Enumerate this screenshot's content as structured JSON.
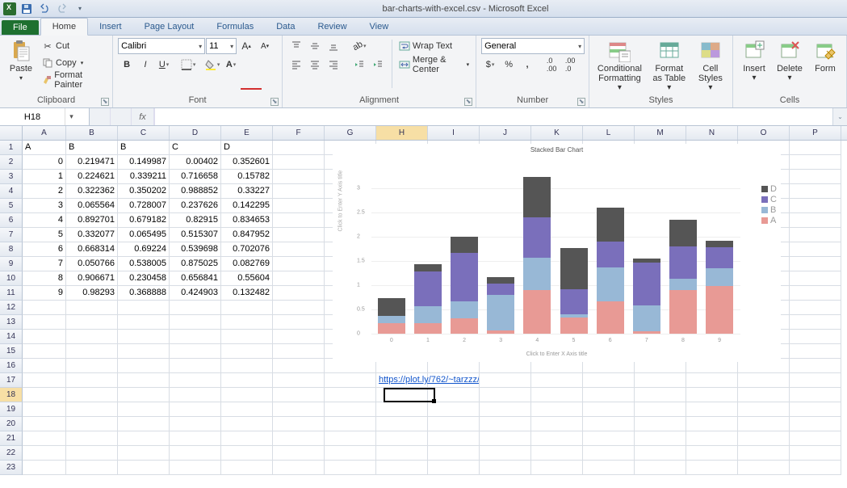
{
  "window_title": "bar-charts-with-excel.csv - Microsoft Excel",
  "tabs": {
    "file": "File",
    "home": "Home",
    "insert": "Insert",
    "page_layout": "Page Layout",
    "formulas": "Formulas",
    "data": "Data",
    "review": "Review",
    "view": "View"
  },
  "clipboard": {
    "paste": "Paste",
    "cut": "Cut",
    "copy": "Copy",
    "fp": "Format Painter",
    "label": "Clipboard"
  },
  "font": {
    "name": "Calibri",
    "size": "11",
    "label": "Font"
  },
  "alignment": {
    "wrap": "Wrap Text",
    "merge": "Merge & Center",
    "label": "Alignment"
  },
  "number": {
    "format": "General",
    "label": "Number"
  },
  "styles": {
    "cf": "Conditional",
    "cf2": "Formatting",
    "ft": "Format",
    "ft2": "as Table",
    "cs": "Cell",
    "cs2": "Styles",
    "label": "Styles"
  },
  "cells": {
    "insert": "Insert",
    "delete": "Delete",
    "format": "Form",
    "label": "Cells"
  },
  "namebox": "H18",
  "col_letters": [
    "A",
    "B",
    "C",
    "D",
    "E",
    "F",
    "G",
    "H",
    "I",
    "J",
    "K",
    "L",
    "M",
    "N",
    "O",
    "P"
  ],
  "header_row": [
    "A",
    "B",
    "B",
    "C",
    "D"
  ],
  "data_rows": [
    [
      "0",
      "0.219471",
      "0.149987",
      "0.00402",
      "0.352601"
    ],
    [
      "1",
      "0.224621",
      "0.339211",
      "0.716658",
      "0.15782"
    ],
    [
      "2",
      "0.322362",
      "0.350202",
      "0.988852",
      "0.33227"
    ],
    [
      "3",
      "0.065564",
      "0.728007",
      "0.237626",
      "0.142295"
    ],
    [
      "4",
      "0.892701",
      "0.679182",
      "0.82915",
      "0.834653"
    ],
    [
      "5",
      "0.332077",
      "0.065495",
      "0.515307",
      "0.847952"
    ],
    [
      "6",
      "0.668314",
      "0.69224",
      "0.539698",
      "0.702076"
    ],
    [
      "7",
      "0.050766",
      "0.538005",
      "0.875025",
      "0.082769"
    ],
    [
      "8",
      "0.906671",
      "0.230458",
      "0.656841",
      "0.55604"
    ],
    [
      "9",
      "0.98293",
      "0.368888",
      "0.424903",
      "0.132482"
    ]
  ],
  "link_cell": "https://plot.ly/762/~tarzzz/",
  "chart_data": {
    "type": "bar",
    "stacked": true,
    "title": "Stacked Bar Chart",
    "xlabel": "Click to Enter X Axis title",
    "ylabel": "Click to Enter Y Axis title",
    "categories": [
      "0",
      "1",
      "2",
      "3",
      "4",
      "5",
      "6",
      "7",
      "8",
      "9"
    ],
    "series": [
      {
        "name": "A",
        "color": "#e89a95",
        "values": [
          0.219471,
          0.224621,
          0.322362,
          0.065564,
          0.892701,
          0.332077,
          0.668314,
          0.050766,
          0.906671,
          0.98293
        ]
      },
      {
        "name": "B",
        "color": "#98b8d6",
        "values": [
          0.149987,
          0.339211,
          0.350202,
          0.728007,
          0.679182,
          0.065495,
          0.69224,
          0.538005,
          0.230458,
          0.368888
        ]
      },
      {
        "name": "C",
        "color": "#7a6fbb",
        "values": [
          0.00402,
          0.716658,
          0.988852,
          0.237626,
          0.82915,
          0.515307,
          0.539698,
          0.875025,
          0.656841,
          0.424903
        ]
      },
      {
        "name": "D",
        "color": "#555555",
        "values": [
          0.352601,
          0.15782,
          0.33227,
          0.142295,
          0.834653,
          0.847952,
          0.702076,
          0.082769,
          0.55604,
          0.132482
        ]
      }
    ],
    "ylim": [
      0,
      3.5
    ],
    "yticks": [
      0,
      0.5,
      1,
      1.5,
      2,
      2.5,
      3
    ]
  },
  "legend_labels": [
    "D",
    "C",
    "B",
    "A"
  ]
}
